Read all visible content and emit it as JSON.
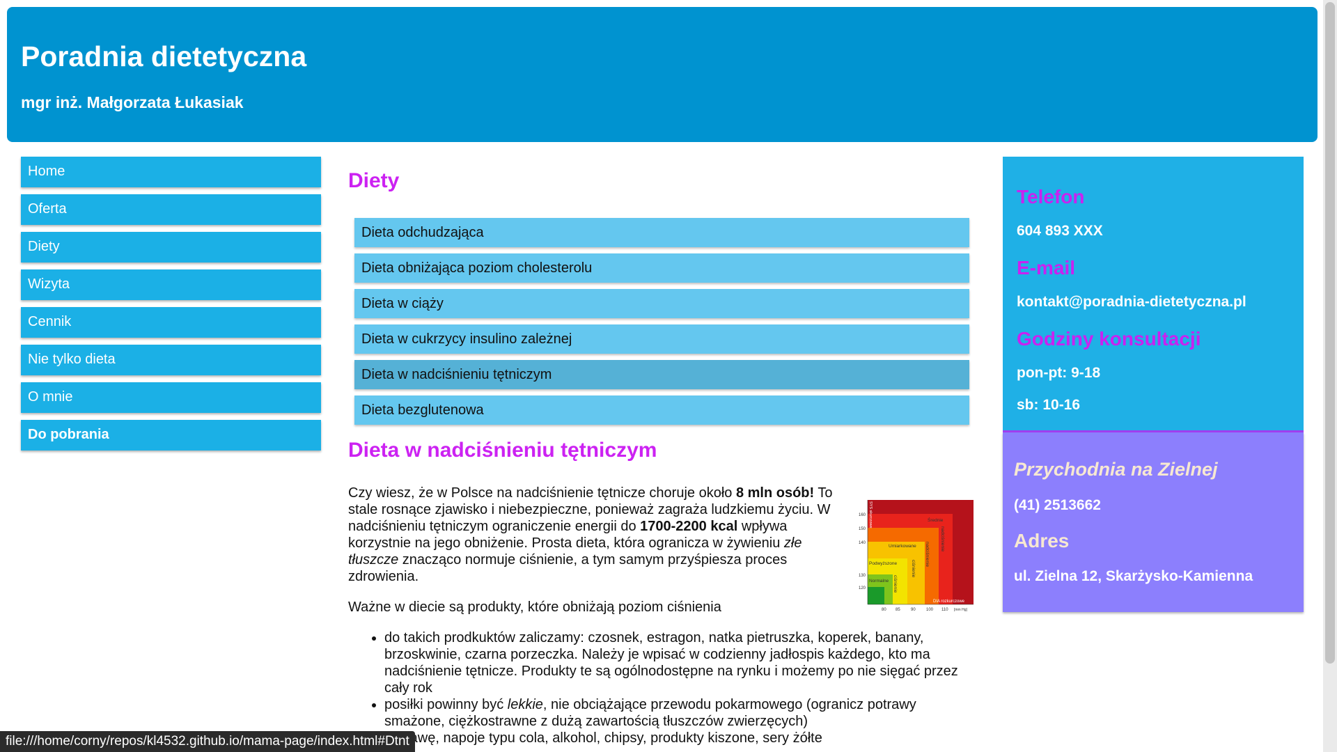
{
  "header": {
    "title": "Poradnia dietetyczna",
    "subtitle": "mgr inż. Małgorzata Łukasiak"
  },
  "nav": {
    "items": [
      {
        "label": "Home"
      },
      {
        "label": "Oferta"
      },
      {
        "label": "Diety"
      },
      {
        "label": "Wizyta"
      },
      {
        "label": "Cennik"
      },
      {
        "label": "Nie tylko dieta"
      },
      {
        "label": "O mnie"
      },
      {
        "label": "Do pobrania"
      }
    ]
  },
  "main": {
    "heading": "Diety",
    "diets": [
      {
        "label": "Dieta odchudzająca"
      },
      {
        "label": "Dieta obniżająca poziom cholesterolu"
      },
      {
        "label": "Dieta w ciąży"
      },
      {
        "label": "Dieta w cukrzycy insulino zależnej"
      },
      {
        "label": "Dieta w nadciśnieniu tętniczym"
      },
      {
        "label": "Dieta bezglutenowa"
      }
    ],
    "article_title": "Dieta w nadciśnieniu tętniczym",
    "p1": {
      "t1": "Czy wiesz, że w Polsce na nadciśnienie tętnicze choruje około ",
      "b1": "8 mln osób!",
      "t2": " To stale rosnące zjawisko i niebezpieczne, ponieważ zagraża ludzkiemu życiu. W nadciśnieniu tętniczym ograniczenie energii do ",
      "b2": "1700-2200 kcal",
      "t3": " wpływa korzystnie na jego obniżenie. Prosta dieta, która ogranicza w żywieniu ",
      "i1": "złe tłuszcze",
      "t4": " znacząco normuje ciśnienie, a tym samym przyśpiesza proces zdrowienia."
    },
    "p2": "Ważne w diecie są produkty, które obniżają poziom ciśnienia",
    "li1": "do takich prodkuktów zaliczamy: czosnek, estragon, natka pietruszka, koperek, banany, brzoskwinie, czarna porzeczka. Należy je wpisać w codzienny jadłospis każdego, kto ma nadciśnienie tętnicze. Produkty te są ogólnodostępne na rynku i możemy po nie sięgać przez cały rok",
    "li2": {
      "t1": "posiłki powinny być ",
      "i1": "lekkie",
      "t2": ", nie obciążające przewodu pokarmowego (ogranicz potrawy smażone, ciężkostrawne z dużą zawartością tłuszczów zwierzęcych)"
    },
    "li3": "ól, kawę, napoje typu cola, alkohol, chipsy, produkty kiszone, sery żółte",
    "chart_labels": {
      "l1": "Normalne",
      "l2": "Podwyższone",
      "l3": "Umiarkowane",
      "l4": "Średnie",
      "l5": "ciśnienie",
      "l6": "ciśnienie",
      "l7": "nadciśnienie",
      "l8": "nadciśnienie",
      "l9": "DIA rozkurczowe",
      "y1": "160",
      "y2": "150",
      "y3": "140",
      "y4": "130",
      "y5": "120",
      "x1": "80",
      "x2": "85",
      "x3": "90",
      "x4": "100",
      "x5": "110",
      "x6": "[mm Hg]",
      "v1": "SYS skurczowe"
    }
  },
  "contact": {
    "phone_heading": "Telefon",
    "phone": "604 893 XXX",
    "email_heading": "E-mail",
    "email": "kontakt@poradnia-dietetyczna.pl",
    "hours_heading": "Godziny konsultacji",
    "hours1": "pon-pt: 9-18",
    "hours2": "sb: 10-16"
  },
  "clinic": {
    "name": "Przychodnia na Zielnej",
    "phone": "(41) 2513662",
    "address_heading": "Adres",
    "address": "ul. Zielna 12, Skarżysko-Kamienna"
  },
  "status_bar": {
    "url": "file:///home/corny/repos/kl4532.github.io/mama-page/index.html#Dtnt"
  },
  "colors": {
    "header_bg": "#0093d0",
    "nav_bg": "#1bb0e6",
    "diet_item_bg": "#64c7ef",
    "heading_accent": "#cc22f2",
    "clinic_bg": "#8c7ffd"
  }
}
